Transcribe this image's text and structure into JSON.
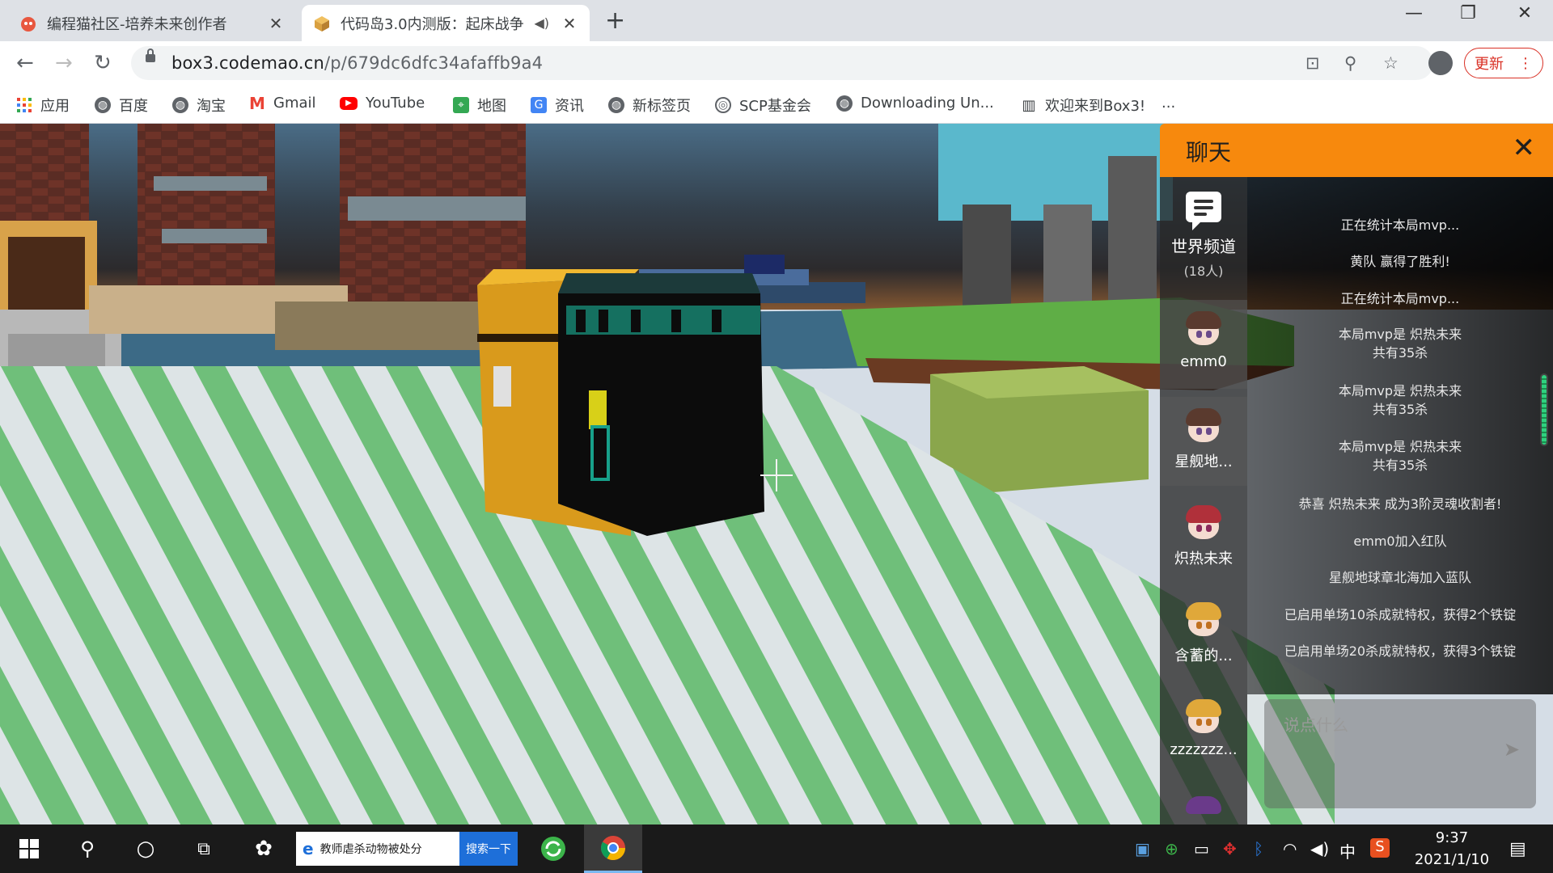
{
  "browser": {
    "tabs": [
      {
        "title": "编程猫社区-培养未来创作者",
        "active": false
      },
      {
        "title": "代码岛3.0内测版：起床战争",
        "active": true
      }
    ],
    "url_domain": "box3.codemao.cn",
    "url_path": "/p/679dc6dfc34afaffb9a4",
    "update_label": "更新",
    "bookmarks": [
      {
        "label": "应用",
        "icon": "apps-grid-icon"
      },
      {
        "label": "百度",
        "icon": "globe-icon"
      },
      {
        "label": "淘宝",
        "icon": "globe-icon"
      },
      {
        "label": "Gmail",
        "icon": "gmail-icon"
      },
      {
        "label": "YouTube",
        "icon": "youtube-icon"
      },
      {
        "label": "地图",
        "icon": "maps-icon"
      },
      {
        "label": "资讯",
        "icon": "news-icon"
      },
      {
        "label": "新标签页",
        "icon": "globe-icon"
      },
      {
        "label": "SCP基金会",
        "icon": "scp-icon"
      },
      {
        "label": "Downloading Un...",
        "icon": "globe-icon"
      },
      {
        "label": "欢迎来到Box3!",
        "icon": "book-icon"
      }
    ],
    "bookmarks_overflow": "..."
  },
  "chat": {
    "title": "聊天",
    "channel": {
      "name": "世界频道",
      "count": "(18人)"
    },
    "players": [
      {
        "name": "emm0",
        "hair": "#5a3a2e",
        "selected": true
      },
      {
        "name": "星舰地...",
        "hair": "#5a3a2e",
        "selected": true
      },
      {
        "name": "炽热未来",
        "hair": "#b0303a",
        "selected": false
      },
      {
        "name": "含蓄的...",
        "hair": "#e0a83a",
        "selected": false
      },
      {
        "name": "zzzzzzz...",
        "hair": "#e0a83a",
        "selected": false
      }
    ],
    "messages": [
      "正在统计本局mvp...",
      "黄队 赢得了胜利!",
      "正在统计本局mvp...",
      "本局mvp是 炽热未来\n共有35杀",
      "本局mvp是 炽热未来\n共有35杀",
      "本局mvp是 炽热未来\n共有35杀",
      "恭喜 炽热未来 成为3阶灵魂收割者!",
      "emm0加入红队",
      "星舰地球章北海加入蓝队",
      "已启用单场10杀成就特权，获得2个铁锭",
      "已启用单场20杀成就特权，获得3个铁锭"
    ],
    "input_placeholder": "说点什么"
  },
  "taskbar": {
    "search_text": "教师虐杀动物被处分",
    "search_button": "搜索一下",
    "ime": "中",
    "time": "9:37",
    "date": "2021/1/10"
  }
}
